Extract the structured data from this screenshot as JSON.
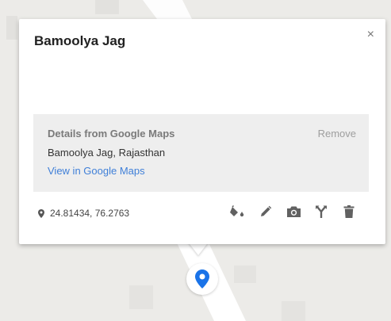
{
  "card": {
    "title": "Bamoolya Jag",
    "close_label": "×"
  },
  "details": {
    "heading": "Details from Google Maps",
    "remove_label": "Remove",
    "place": "Bamoolya Jag, Rajasthan",
    "view_link": "View in Google Maps"
  },
  "location": {
    "coordinates": "24.81434, 76.2763",
    "icon": "location-pin-icon"
  },
  "toolbar": [
    {
      "icon": "paint-bucket-icon"
    },
    {
      "icon": "pencil-icon"
    },
    {
      "icon": "camera-icon"
    },
    {
      "icon": "directions-fork-icon"
    },
    {
      "icon": "trash-icon"
    }
  ],
  "colors": {
    "accent_link": "#3f7fd8",
    "marker_blue": "#1a73e8",
    "details_bg": "#eeeeee",
    "map_bg": "#ecebe8"
  }
}
